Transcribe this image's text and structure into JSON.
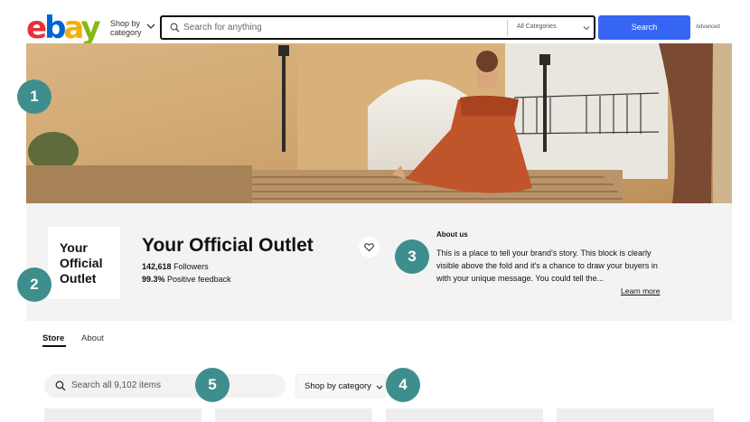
{
  "header": {
    "logo": {
      "e": "e",
      "b": "b",
      "a": "a",
      "y": "y",
      "colors": [
        "#e53238",
        "#0064d2",
        "#f5af02",
        "#86b817"
      ]
    },
    "shop_by_category": "Shop by category",
    "search": {
      "placeholder": "Search for anything",
      "category": "All Categories",
      "button": "Search",
      "advanced": "Advanced"
    }
  },
  "store": {
    "logo_text": [
      "Your",
      "Official",
      "Outlet"
    ],
    "name": "Your Official Outlet",
    "followers_count": "142,618",
    "followers_label": "Followers",
    "feedback_percent": "99.3%",
    "feedback_label": "Positive feedback",
    "about_title": "About us",
    "about_text": "This is a place to tell your brand's story. This block is clearly visible above the fold and it's a chance to draw your buyers in with your unique message. You could tell the...",
    "learn_more": "Learn more"
  },
  "tabs": [
    {
      "label": "Store",
      "active": true
    },
    {
      "label": "About",
      "active": false
    }
  ],
  "store_search": {
    "placeholder": "Search all 9,102 items",
    "shop_by_category": "Shop by category"
  },
  "callouts": [
    "1",
    "2",
    "3",
    "4",
    "5"
  ],
  "colors": {
    "accent": "#3665f3",
    "callout": "#3f8e8e",
    "info_band": "#f3f3f4"
  }
}
